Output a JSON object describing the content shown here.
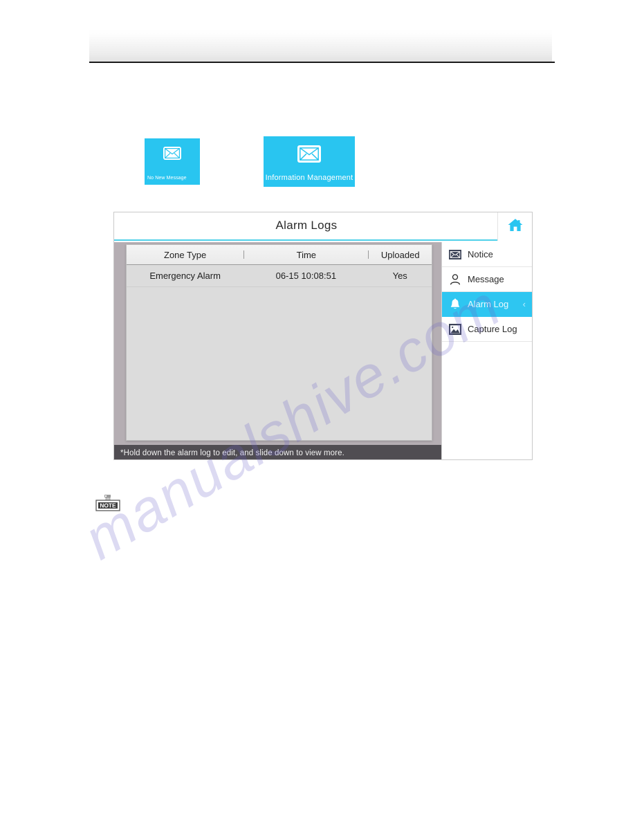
{
  "watermark": {
    "text": "manualshive.com"
  },
  "header": {
    "title": ""
  },
  "tiles": [
    {
      "id": "no-new-message",
      "label": "No New Message",
      "icon": "envelope-icon",
      "color": "#29c5f0"
    },
    {
      "id": "information-management",
      "label": "Information Management",
      "icon": "envelope-icon",
      "color": "#29c5f0"
    }
  ],
  "device": {
    "titlebar": {
      "title": "Alarm Logs",
      "home_icon": "home-icon",
      "accent_color": "#4fd1e9"
    },
    "table": {
      "columns": [
        "Zone Type",
        "Time",
        "Uploaded"
      ],
      "rows": [
        {
          "zone_type": "Emergency Alarm",
          "time": "06-15 10:08:51",
          "uploaded": "Yes"
        }
      ]
    },
    "footer_hint": "*Hold down the alarm log to edit, and slide down to view more.",
    "menu": {
      "items": [
        {
          "label": "Notice",
          "icon": "envelope-icon",
          "active": false
        },
        {
          "label": "Message",
          "icon": "person-icon",
          "active": false
        },
        {
          "label": "Alarm Log",
          "icon": "bell-icon",
          "active": true,
          "chevron": "‹"
        },
        {
          "label": "Capture Log",
          "icon": "image-icon",
          "active": false
        }
      ],
      "active_color": "#2ec6f1"
    }
  },
  "note": {
    "label": "NOTE"
  }
}
